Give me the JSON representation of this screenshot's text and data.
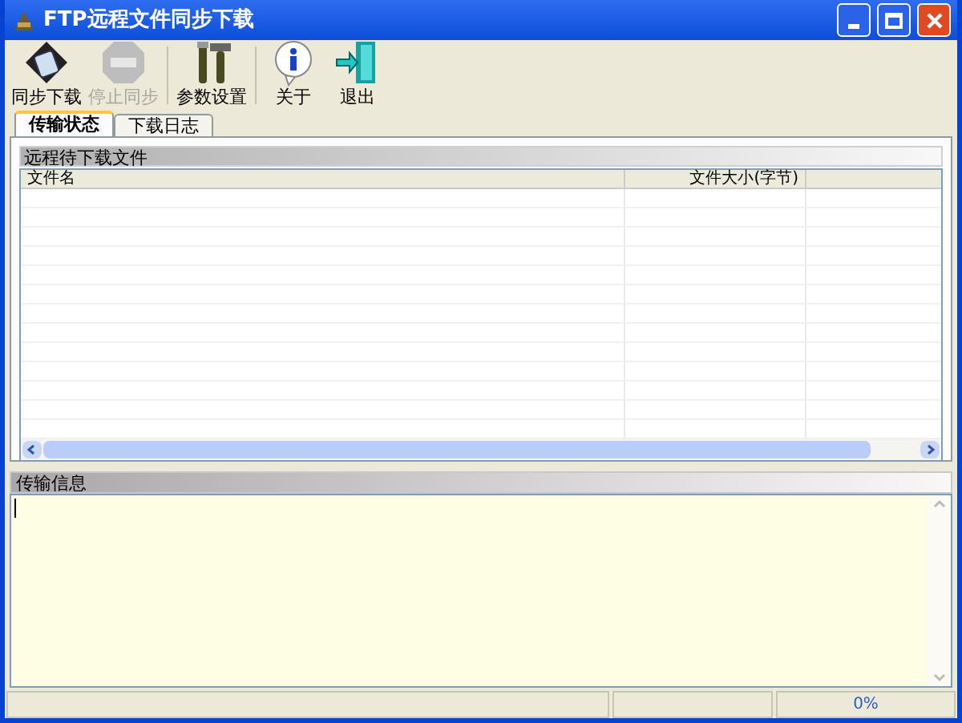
{
  "window": {
    "title": "FTP远程文件同步下载"
  },
  "toolbar": [
    {
      "label": "同步下载",
      "kind": "sync",
      "disabled": false
    },
    {
      "label": "停止同步",
      "kind": "stop",
      "disabled": true
    },
    {
      "label": "参数设置",
      "kind": "tools",
      "disabled": false
    },
    {
      "label": "关于",
      "kind": "info",
      "disabled": false
    },
    {
      "label": "退出",
      "kind": "exit",
      "disabled": false
    }
  ],
  "tabs": [
    {
      "label": "传输状态",
      "selected": true
    },
    {
      "label": "下载日志",
      "selected": false
    }
  ],
  "remote_files": {
    "title": "远程待下载文件",
    "columns": [
      "文件名",
      "文件大小(字节)"
    ]
  },
  "transfer_info": {
    "title": "传输信息"
  },
  "status_bar": {
    "progress": "0%"
  }
}
